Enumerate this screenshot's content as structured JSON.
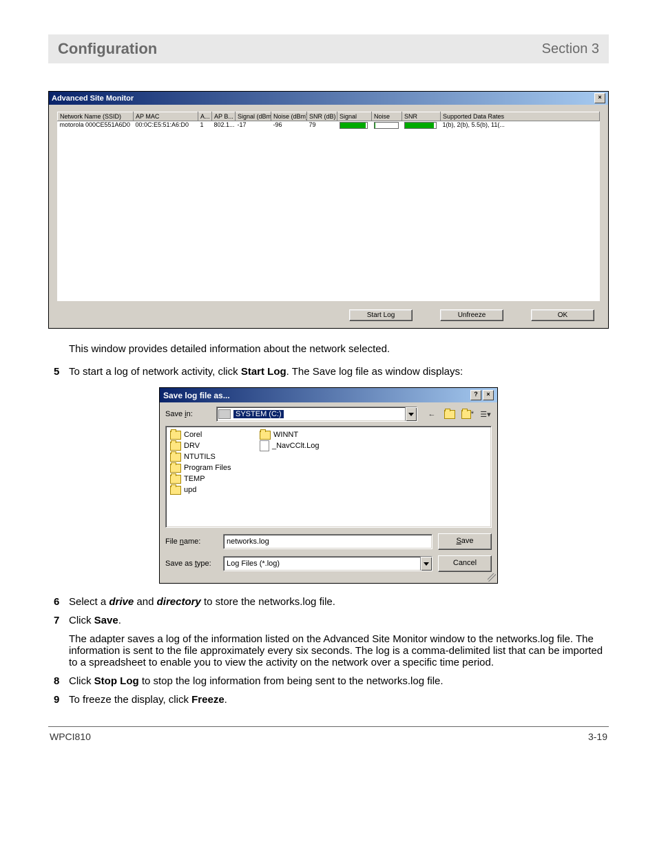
{
  "header": {
    "title": "Configuration",
    "section": "Section 3"
  },
  "site_monitor": {
    "title": "Advanced Site Monitor",
    "columns": [
      "Network Name (SSID)",
      "AP MAC",
      "A...",
      "AP B...",
      "Signal (dBm)",
      "Noise (dBm)",
      "SNR (dB)",
      "Signal",
      "Noise",
      "SNR",
      "Supported Data Rates"
    ],
    "row": {
      "ssid": "motorola 000CE551A6D0",
      "ap_mac": "00:0C:E5:51:A6:D0",
      "a": "1",
      "ap_b": "802.1...",
      "signal_dbm": "-17",
      "noise_dbm": "-96",
      "snr_db": "79",
      "signal_bar_pct": 95,
      "noise_bar_pct": 5,
      "snr_bar_pct": 95,
      "rates": "1(b), 2(b), 5.5(b), 11(..."
    },
    "buttons": {
      "start_log": "Start Log",
      "unfreeze": "Unfreeze",
      "ok": "OK"
    }
  },
  "text": {
    "after_monitor": "This window provides detailed information about the network selected.",
    "step5_a": "To start a log of network activity, click ",
    "step5_b": "Start Log",
    "step5_c": ". The Save log file as window displays:",
    "step6_a": "Select a ",
    "step6_b": "drive",
    "step6_c": " and ",
    "step6_d": "directory",
    "step6_e": " to store the networks.log file.",
    "step7_a": "Click ",
    "step7_b": "Save",
    "step7_c": ".",
    "step7_para": "The adapter saves a log of the information listed on the Advanced Site Monitor window to the networks.log file. The information is sent to the file approximately every six seconds. The log is a comma-delimited list that can be imported to a spreadsheet to enable you to view the activity on the network over a specific time period.",
    "step8_a": "Click ",
    "step8_b": "Stop Log",
    "step8_c": " to stop the log information from being sent to the networks.log file.",
    "step9_a": "To freeze the display, click ",
    "step9_b": "Freeze",
    "step9_c": "."
  },
  "save_dialog": {
    "title": "Save log file as...",
    "save_in_label": "Save in:",
    "save_in_value": "SYSTEM (C:)",
    "folders_col1": [
      "Corel",
      "DRV",
      "NTUTILS",
      "Program Files",
      "TEMP",
      "upd"
    ],
    "folders_col2": [
      "WINNT"
    ],
    "files_col2": [
      "_NavCClt.Log"
    ],
    "file_name_label": "File name:",
    "file_name_value": "networks.log",
    "save_as_type_label": "Save as type:",
    "save_as_type_value": "Log Files (*.log)",
    "save_btn": "Save",
    "cancel_btn": "Cancel"
  },
  "footer": {
    "left": "WPCI810",
    "right": "3-19"
  },
  "nums": {
    "n5": "5",
    "n6": "6",
    "n7": "7",
    "n8": "8",
    "n9": "9"
  }
}
